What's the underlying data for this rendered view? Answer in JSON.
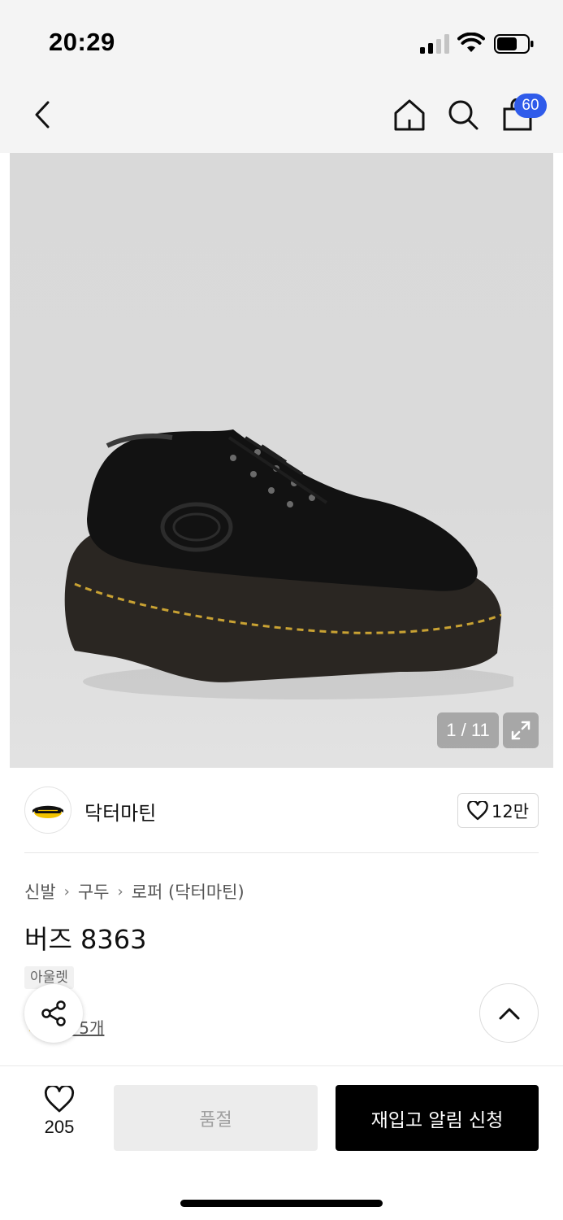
{
  "status_bar": {
    "time": "20:29"
  },
  "header": {
    "cart_badge": "60"
  },
  "gallery": {
    "counter": "1 / 11"
  },
  "brand": {
    "name": "닥터마틴",
    "logo_text": "Dr. Martens",
    "like_count": "12만"
  },
  "breadcrumb": [
    {
      "label": "신발"
    },
    {
      "label": "구두"
    },
    {
      "label": "로퍼 (닥터마틴)"
    }
  ],
  "product": {
    "title": "버즈 8363",
    "tag": "아울렛",
    "review_text": "후기 5개"
  },
  "actions": {
    "wish_count": "205",
    "soldout_label": "품절",
    "restock_label": "재입고 알림 신청"
  },
  "colors": {
    "accent_badge": "#2f5bea",
    "primary_button": "#000000",
    "disabled_button": "#ececec"
  }
}
